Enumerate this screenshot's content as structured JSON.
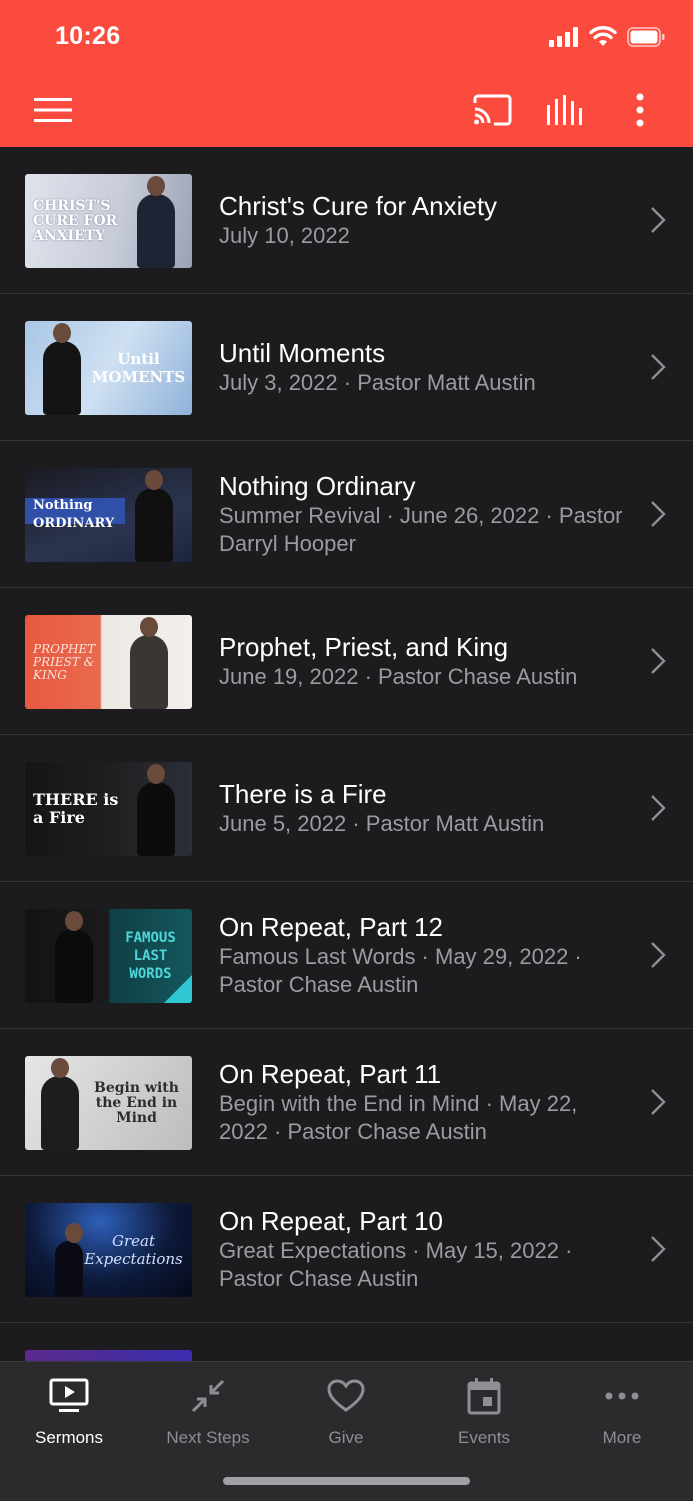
{
  "status_bar": {
    "time": "10:26"
  },
  "header": {
    "menu_icon": "hamburger-menu-icon",
    "cast_icon": "cast-icon",
    "audio_icon": "audio-bars-icon",
    "more_icon": "vertical-dots-icon",
    "background": "#fb4b3e"
  },
  "sermons": [
    {
      "title": "Christ's Cure for Anxiety",
      "subtitle": "July 10, 2022",
      "thumb_text": "CHRIST'S CURE FOR ANXIETY"
    },
    {
      "title": "Until Moments",
      "subtitle": "July 3, 2022 · Pastor Matt Austin",
      "thumb_text": "Until MOMENTS"
    },
    {
      "title": "Nothing Ordinary",
      "subtitle": "Summer Revival · June 26, 2022 · Pastor Darryl Hooper",
      "thumb_text": "Nothing ORDINARY"
    },
    {
      "title": "Prophet, Priest, and King",
      "subtitle": "June 19, 2022 · Pastor Chase Austin",
      "thumb_text": "PROPHET PRIEST & KING"
    },
    {
      "title": "There is a Fire",
      "subtitle": "June 5, 2022 · Pastor Matt Austin",
      "thumb_text": "THERE is a Fire"
    },
    {
      "title": "On Repeat, Part 12",
      "subtitle": "Famous Last Words · May 29, 2022 · Pastor Chase Austin",
      "thumb_text": "FAMOUS LAST WORDS"
    },
    {
      "title": "On Repeat, Part 11",
      "subtitle": "Begin with the End in Mind · May 22, 2022 · Pastor Chase Austin",
      "thumb_text": "Begin with the End in Mind"
    },
    {
      "title": "On Repeat, Part 10",
      "subtitle": "Great Expectations · May 15, 2022 · Pastor Chase Austin",
      "thumb_text": "Great Expectations"
    }
  ],
  "tabs": [
    {
      "label": "Sermons",
      "icon": "tv-icon",
      "active": true
    },
    {
      "label": "Next Steps",
      "icon": "arrows-in-icon",
      "active": false
    },
    {
      "label": "Give",
      "icon": "heart-icon",
      "active": false
    },
    {
      "label": "Events",
      "icon": "calendar-icon",
      "active": false
    },
    {
      "label": "More",
      "icon": "horizontal-dots-icon",
      "active": false
    }
  ]
}
